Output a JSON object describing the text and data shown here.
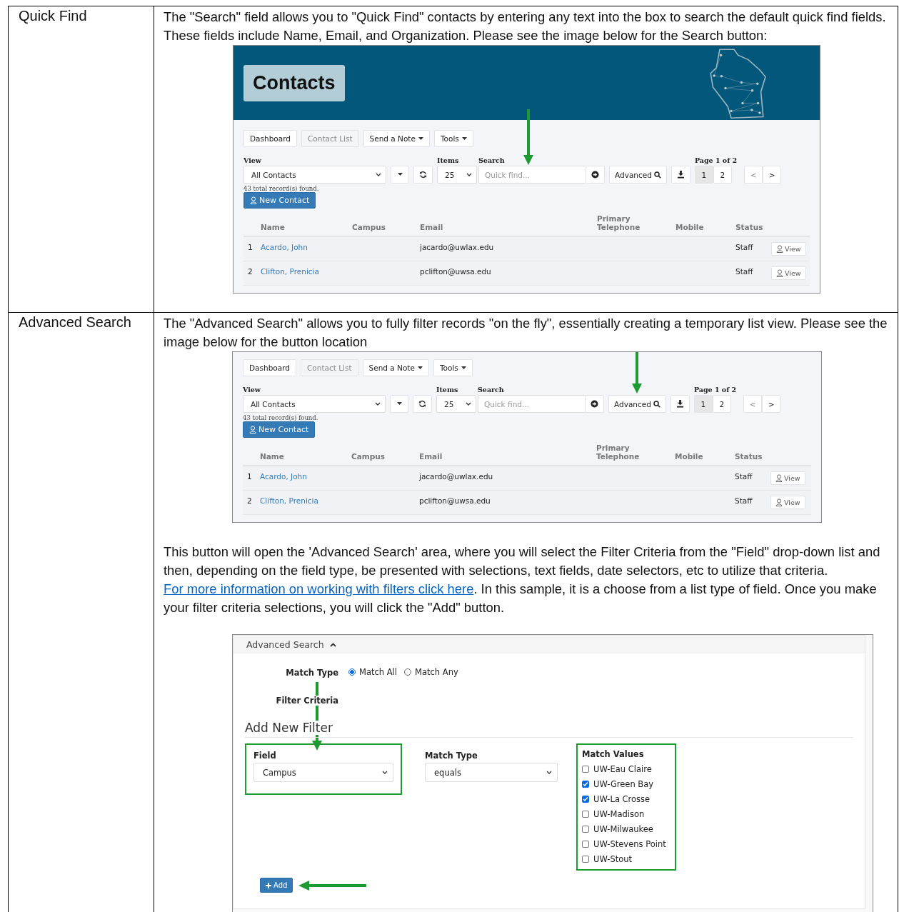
{
  "rows": [
    {
      "label": "Quick Find",
      "blocks": [
        {
          "kind": "text",
          "parts": [
            {
              "kind": "text",
              "text": "The \"Search\" field allows you to \"Quick Find\" contacts by entering any text into the box to search the default quick find fields.  These fields include Name, Email, and Organization. Please see the image below for the Search button:"
            }
          ]
        },
        {
          "kind": "contacts",
          "header": {
            "title": "Contacts"
          },
          "nav": [
            {
              "label": "Dashboard",
              "current": false,
              "dropdown": false
            },
            {
              "label": "Contact List",
              "current": true,
              "dropdown": false
            },
            {
              "label": "Send a Note",
              "current": false,
              "dropdown": true
            },
            {
              "label": "Tools",
              "current": false,
              "dropdown": true
            }
          ],
          "view": {
            "label": "View",
            "value": "All Contacts"
          },
          "items": {
            "label": "Items",
            "value": "25"
          },
          "search": {
            "label": "Search",
            "placeholder": "Quick find...",
            "pointed": true
          },
          "advanced": {
            "label": "Advanced",
            "pointed": false
          },
          "page_label": "Page 1 of 2",
          "pages": [
            {
              "label": "1",
              "selected": true
            },
            {
              "label": "2",
              "selected": false
            }
          ],
          "prev": "<",
          "next": ">",
          "record_count": "43 total record(s) found.",
          "new_button": "New Contact",
          "columns": [
            "Name",
            "Campus",
            "Email",
            "Primary Telephone",
            "Mobile",
            "Status"
          ],
          "table_rows": [
            {
              "number": "1",
              "name": "Acardo, John",
              "email": "jacardo@uwlax.edu",
              "status": "Staff",
              "action": "View"
            },
            {
              "number": "2",
              "name": "Clifton, Prenicia",
              "email": "pclifton@uwsa.edu",
              "status": "Staff",
              "action": "View"
            }
          ]
        }
      ]
    },
    {
      "label": "Advanced Search",
      "blocks": [
        {
          "kind": "text",
          "parts": [
            {
              "kind": "text",
              "text": "The \"Advanced Search\" allows you to fully filter records \"on the fly\", essentially creating a temporary list view.  Please see the image below for the button location"
            }
          ]
        },
        {
          "kind": "contacts",
          "nav": [
            {
              "label": "Dashboard",
              "current": false,
              "dropdown": false
            },
            {
              "label": "Contact List",
              "current": true,
              "dropdown": false
            },
            {
              "label": "Send a Note",
              "current": false,
              "dropdown": true
            },
            {
              "label": "Tools",
              "current": false,
              "dropdown": true
            }
          ],
          "view": {
            "label": "View",
            "value": "All Contacts"
          },
          "items": {
            "label": "Items",
            "value": "25"
          },
          "search": {
            "label": "Search",
            "placeholder": "Quick find...",
            "pointed": false
          },
          "advanced": {
            "label": "Advanced",
            "pointed": true
          },
          "page_label": "Page 1 of 2",
          "pages": [
            {
              "label": "1",
              "selected": true
            },
            {
              "label": "2",
              "selected": false
            }
          ],
          "prev": "<",
          "next": ">",
          "record_count": "43 total record(s) found.",
          "new_button": "New Contact",
          "columns": [
            "Name",
            "Campus",
            "Email",
            "Primary Telephone",
            "Mobile",
            "Status"
          ],
          "table_rows": [
            {
              "number": "1",
              "name": "Acardo, John",
              "email": "jacardo@uwlax.edu",
              "status": "Staff",
              "action": "View"
            },
            {
              "number": "2",
              "name": "Clifton, Prenicia",
              "email": "pclifton@uwsa.edu",
              "status": "Staff",
              "action": "View"
            }
          ]
        },
        {
          "kind": "text",
          "parts": [
            {
              "kind": "text",
              "text": "This button will open the  'Advanced Search' area, where you will select the Filter Criteria from the \"Field\" drop-down list and then, depending on the field type, be presented with selections, text fields, date selectors, etc to utilize that criteria. "
            },
            {
              "kind": "link",
              "text": "For more information on working with filters click here"
            },
            {
              "kind": "text",
              "text": ". In this sample, it is a choose from a list type of field. Once you make your filter criteria selections, you will click the \"Add\" button."
            }
          ]
        },
        {
          "kind": "advanced_search",
          "title": "Advanced Search",
          "expanded": true,
          "match_type": {
            "label": "Match Type",
            "options": [
              {
                "label": "Match All",
                "selected": true
              },
              {
                "label": "Match Any",
                "selected": false
              }
            ]
          },
          "filter_criteria": "Filter Criteria",
          "add_heading": "Add New Filter",
          "field": {
            "label": "Field",
            "value": "Campus",
            "highlighted": true
          },
          "match": {
            "label": "Match Type",
            "value": "equals"
          },
          "values": {
            "label": "Match Values",
            "highlighted": true,
            "options": [
              {
                "label": "UW-Eau Claire",
                "checked": false
              },
              {
                "label": "UW-Green Bay",
                "checked": true
              },
              {
                "label": "UW-La Crosse",
                "checked": true
              },
              {
                "label": "UW-Madison",
                "checked": false
              },
              {
                "label": "UW-Milwaukee",
                "checked": false
              },
              {
                "label": "UW-Stevens Point",
                "checked": false
              },
              {
                "label": "UW-Stout",
                "checked": false
              }
            ]
          },
          "add_button": "Add",
          "add_pointed": true
        }
      ]
    }
  ]
}
